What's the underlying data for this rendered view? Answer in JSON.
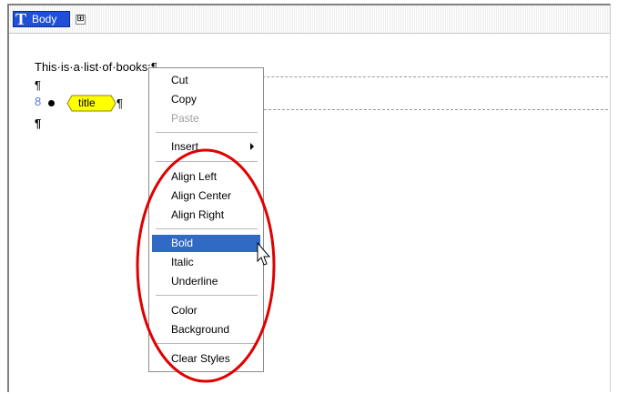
{
  "editor": {
    "root_tag": "Body",
    "root_tag_icon": "T",
    "expand_symbol": "⊞",
    "text_line": "This·is·a·list·of·books:¶",
    "pilcrow": "¶",
    "list_number": "8",
    "inline_tag_label": "title",
    "icons": [
      "text-element-icon",
      "expand-icon",
      "bullet-icon",
      "mouse-cursor-icon"
    ]
  },
  "context_menu": {
    "items": [
      {
        "label": "Cut",
        "enabled": true
      },
      {
        "label": "Copy",
        "enabled": true
      },
      {
        "label": "Paste",
        "enabled": false
      },
      {
        "label": "Insert",
        "enabled": true,
        "submenu": true
      },
      {
        "label": "Align Left",
        "enabled": true
      },
      {
        "label": "Align Center",
        "enabled": true
      },
      {
        "label": "Align Right",
        "enabled": true
      },
      {
        "label": "Bold",
        "enabled": true,
        "highlighted": true
      },
      {
        "label": "Italic",
        "enabled": true
      },
      {
        "label": "Underline",
        "enabled": true
      },
      {
        "label": "Color",
        "enabled": true
      },
      {
        "label": "Background",
        "enabled": true
      },
      {
        "label": "Clear Styles",
        "enabled": true
      }
    ]
  },
  "colors": {
    "tag_blue": "#1f4fd6",
    "inline_tag_yellow": "#ffff00",
    "menu_highlight": "#316ac5",
    "annotation_red": "#e00000"
  }
}
